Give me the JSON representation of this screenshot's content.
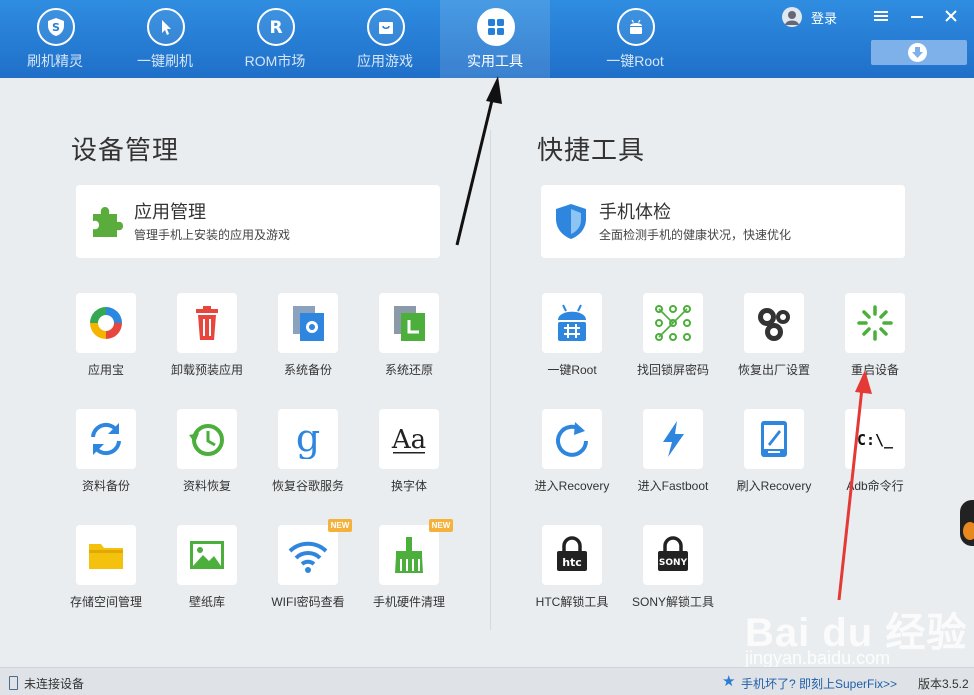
{
  "nav": {
    "tabs": [
      {
        "label": "刷机精灵",
        "icon": "shield-s-icon"
      },
      {
        "label": "一键刷机",
        "icon": "cursor-icon"
      },
      {
        "label": "ROM市场",
        "icon": "rom-r-icon"
      },
      {
        "label": "应用游戏",
        "icon": "bag-icon"
      },
      {
        "label": "实用工具",
        "icon": "grid-icon",
        "active": true
      },
      {
        "label": "一键Root",
        "icon": "android-icon"
      }
    ],
    "login_label": "登录"
  },
  "left_section": {
    "title": "设备管理",
    "card": {
      "title": "应用管理",
      "desc": "管理手机上安装的应用及游戏",
      "icon": "puzzle-icon"
    },
    "tools": [
      {
        "label": "应用宝",
        "icon": "app-store-icon"
      },
      {
        "label": "卸载预装应用",
        "icon": "trash-icon"
      },
      {
        "label": "系统备份",
        "icon": "system-backup-icon"
      },
      {
        "label": "系统还原",
        "icon": "system-restore-icon"
      },
      {
        "label": "资料备份",
        "icon": "sync-icon"
      },
      {
        "label": "资料恢复",
        "icon": "history-icon"
      },
      {
        "label": "恢复谷歌服务",
        "icon": "google-g-icon"
      },
      {
        "label": "换字体",
        "icon": "font-aa-icon"
      },
      {
        "label": "存储空间管理",
        "icon": "folder-icon"
      },
      {
        "label": "壁纸库",
        "icon": "wallpaper-icon"
      },
      {
        "label": "WIFI密码查看",
        "icon": "wifi-icon",
        "badge": "NEW"
      },
      {
        "label": "手机硬件清理",
        "icon": "broom-icon",
        "badge": "NEW"
      }
    ]
  },
  "right_section": {
    "title": "快捷工具",
    "card": {
      "title": "手机体检",
      "desc": "全面检测手机的健康状况，快速优化",
      "icon": "shield-check-icon"
    },
    "tools": [
      {
        "label": "一键Root",
        "icon": "android-root-icon"
      },
      {
        "label": "找回锁屏密码",
        "icon": "pattern-lock-icon"
      },
      {
        "label": "恢复出厂设置",
        "icon": "gears-icon"
      },
      {
        "label": "重启设备",
        "icon": "reboot-spinner-icon"
      },
      {
        "label": "进入Recovery",
        "icon": "refresh-arrow-icon"
      },
      {
        "label": "进入Fastboot",
        "icon": "lightning-icon"
      },
      {
        "label": "刷入Recovery",
        "icon": "tablet-edit-icon"
      },
      {
        "label": "Adb命令行",
        "icon": "terminal-icon",
        "icon_text": "C:\\_"
      },
      {
        "label": "HTC解锁工具",
        "icon": "htc-lock-icon",
        "icon_text": "htc"
      },
      {
        "label": "SONY解锁工具",
        "icon": "sony-lock-icon",
        "icon_text": "SONY"
      }
    ]
  },
  "status": {
    "connection": "未连接设备",
    "superfix_link": "手机坏了? 即刻上SuperFix>>",
    "version": "版本3.5.2"
  },
  "watermark": {
    "brand": "Bai du 经验",
    "url": "jingyan.baidu.com"
  },
  "colors": {
    "header_blue": "#2580d8",
    "tile_blue": "#2f86df",
    "annotation_red": "#e53935",
    "badge": "#f4b23c"
  }
}
